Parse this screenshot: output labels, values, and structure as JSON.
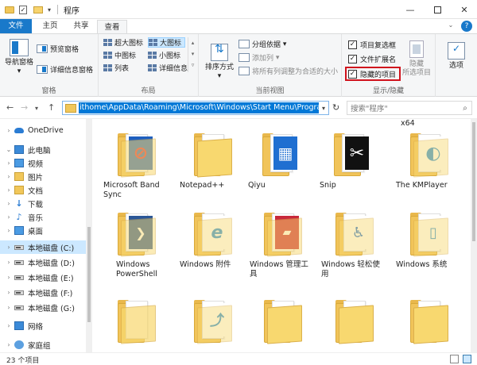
{
  "window": {
    "title": "程序",
    "minimize_glyph": "—",
    "close_glyph": "✕"
  },
  "quick_access": {
    "check_glyph": "✓",
    "dropdown_glyph": "▾"
  },
  "tabs": [
    {
      "label": "文件"
    },
    {
      "label": "主页"
    },
    {
      "label": "共享"
    },
    {
      "label": "查看"
    }
  ],
  "ribbon": {
    "pane_group": {
      "label": "窗格",
      "nav_pane": "导航窗格",
      "preview_pane": "预览窗格",
      "details_pane": "详细信息窗格"
    },
    "layout_group": {
      "label": "布局",
      "items": [
        "超大图标",
        "大图标",
        "中图标",
        "小图标",
        "列表",
        "详细信息"
      ],
      "selected": "大图标"
    },
    "view_group": {
      "label": "当前视图",
      "sort_by": "排序方式",
      "group_by": "分组依据",
      "add_columns": "添加列",
      "fit_columns": "将所有列调整为合适的大小"
    },
    "show_hide_group": {
      "label": "显示/隐藏",
      "item_checkboxes": "项目复选框",
      "file_extensions": "文件扩展名",
      "hidden_items": "隐藏的项目",
      "hide_selected_line1": "隐藏",
      "hide_selected_line2": "所选项目",
      "checked_glyph": "✓"
    },
    "options_label": "选项"
  },
  "address": {
    "path": "ithome\\AppData\\Roaming\\Microsoft\\Windows\\Start Menu\\Programs",
    "search_placeholder": "搜索\"程序\"",
    "back_glyph": "←",
    "forward_glyph": "→",
    "history_glyph": "▾",
    "up_glyph": "↑",
    "refresh_glyph": "↻",
    "search_glyph": "⌕"
  },
  "nav_pane": {
    "items": [
      {
        "label": "OneDrive",
        "icon": "onedrive-icon"
      },
      {
        "label": "此电脑",
        "icon": "this-pc-icon"
      },
      {
        "label": "视频",
        "icon": "videos-icon"
      },
      {
        "label": "图片",
        "icon": "pictures-icon"
      },
      {
        "label": "文档",
        "icon": "documents-icon"
      },
      {
        "label": "下载",
        "icon": "downloads-icon"
      },
      {
        "label": "音乐",
        "icon": "music-icon"
      },
      {
        "label": "桌面",
        "icon": "desktop-icon"
      },
      {
        "label": "本地磁盘 (C:)",
        "icon": "drive-icon"
      },
      {
        "label": "本地磁盘 (D:)",
        "icon": "drive-icon"
      },
      {
        "label": "本地磁盘 (E:)",
        "icon": "drive-icon"
      },
      {
        "label": "本地磁盘 (F:)",
        "icon": "drive-icon"
      },
      {
        "label": "本地磁盘 (G:)",
        "icon": "drive-icon"
      },
      {
        "label": "网络",
        "icon": "network-icon"
      },
      {
        "label": "家庭组",
        "icon": "homegroup-icon"
      }
    ],
    "selected": "本地磁盘 (C:)",
    "expand_glyph": "›",
    "download_glyph": "↓",
    "music_glyph": "♪"
  },
  "content": {
    "x64_label": "x64",
    "items": [
      {
        "label": "Microsoft Band Sync",
        "icon": "microsoft-band-sync-icon",
        "accent": "#1e5fbf"
      },
      {
        "label": "Notepad++",
        "icon": "notepadpp-folder-icon",
        "accent": ""
      },
      {
        "label": "Qiyu",
        "icon": "qiyu-app-icon",
        "accent": "#1f6fd1"
      },
      {
        "label": "Snip",
        "icon": "snip-scissors-icon",
        "accent": "#111111"
      },
      {
        "label": "The KMPlayer",
        "icon": "kmplayer-icon",
        "accent": "#2a8fd8"
      },
      {
        "label": "Windows PowerShell",
        "icon": "powershell-icon",
        "accent": "#2b5797"
      },
      {
        "label": "Windows 附件",
        "icon": "windows-accessories-icon",
        "accent": "#2a8fd8"
      },
      {
        "label": "Windows 管理工具",
        "icon": "admin-tools-icon",
        "accent": "#c8283a"
      },
      {
        "label": "Windows 轻松使用",
        "icon": "ease-of-access-icon",
        "accent": "#1f6fd1"
      },
      {
        "label": "Windows 系统",
        "icon": "windows-system-icon",
        "accent": "#2a8fd8"
      },
      {
        "label": "",
        "icon": "folder-icon",
        "accent": ""
      },
      {
        "label": "",
        "icon": "folder-icon",
        "accent": "#2a8fd8"
      },
      {
        "label": "",
        "icon": "folder-icon",
        "accent": ""
      },
      {
        "label": "",
        "icon": "folder-icon",
        "accent": ""
      },
      {
        "label": "",
        "icon": "folder-icon",
        "accent": ""
      }
    ],
    "glyphs": {
      "band": "⊘",
      "qiyu": "▦",
      "snip": "✂",
      "kmplayer": "◐",
      "powershell": "❯",
      "accessories": "e",
      "admin": "▰",
      "ease": "♿",
      "system": "▯",
      "row3": "⤴"
    }
  },
  "status": {
    "text": "23 个项目"
  }
}
